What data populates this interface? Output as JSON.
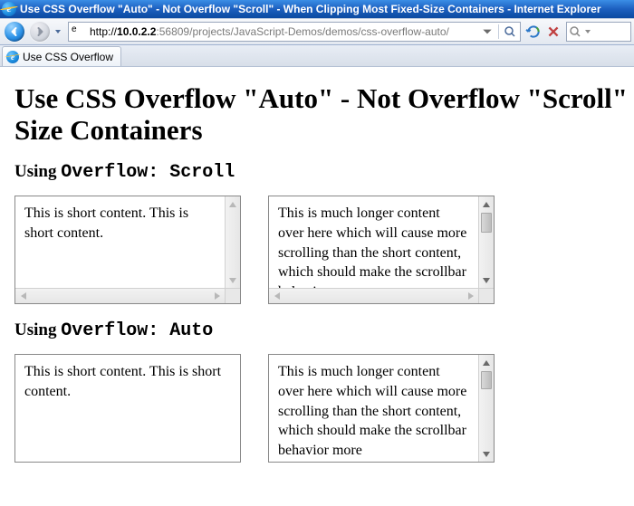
{
  "window": {
    "title": "Use CSS Overflow \"Auto\" - Not Overflow \"Scroll\" - When Clipping Most Fixed-Size Containers - Internet Explorer"
  },
  "toolbar": {
    "url_host": "10.0.2.2",
    "url_rest": ":56809/projects/JavaScript-Demos/demos/css-overflow-auto/"
  },
  "tab": {
    "title": "Use CSS Overflow"
  },
  "page": {
    "h1_line1": "Use CSS Overflow \"Auto\" - Not Overflow \"Scroll\"",
    "h1_line2": "Size Containers",
    "sec1_prefix": "Using ",
    "sec1_code": "Overflow: Scroll",
    "sec2_prefix": "Using ",
    "sec2_code": "Overflow: Auto",
    "short_text": "This is short content. This is short content.",
    "long_text": "This is much longer content over here which will cause more scrolling than the short content, which should make the scrollbar behavior more"
  }
}
